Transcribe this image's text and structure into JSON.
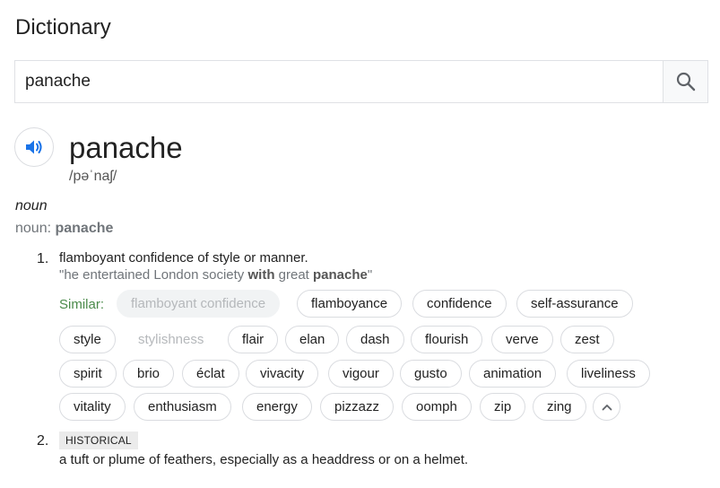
{
  "header": {
    "title": "Dictionary"
  },
  "search": {
    "value": "panache"
  },
  "entry": {
    "word": "panache",
    "phonetic": "/pəˈnaʃ/",
    "pos_italic": "noun",
    "pos_label": "noun: ",
    "pos_word": "panache"
  },
  "definitions": [
    {
      "number": "1.",
      "text": "flamboyant confidence of style or manner.",
      "example": {
        "open": "\"he entertained London society ",
        "strong1": "with",
        "mid": " great ",
        "strong2": "panache",
        "close": "\""
      },
      "similar_label": "Similar:",
      "similar": [
        "flamboyant confidence",
        "flamboyance",
        "confidence",
        "self-assurance",
        "style",
        "stylishness",
        "flair",
        "elan",
        "dash",
        "flourish",
        "verve",
        "zest",
        "spirit",
        "brio",
        "éclat",
        "vivacity",
        "vigour",
        "gusto",
        "animation",
        "liveliness",
        "vitality",
        "enthusiasm",
        "energy",
        "pizzazz",
        "oomph",
        "zip",
        "zing"
      ]
    },
    {
      "number": "2.",
      "badge": "HISTORICAL",
      "text": "a tuft or plume of feathers, especially as a headdress or on a helmet."
    }
  ],
  "icons": {
    "search": "search-icon",
    "speaker": "speaker-icon",
    "collapse": "chevron-up-icon"
  },
  "colors": {
    "speaker_blue": "#1a73e8",
    "similar_green": "#4a8a4a",
    "muted_text": "#70757a"
  }
}
